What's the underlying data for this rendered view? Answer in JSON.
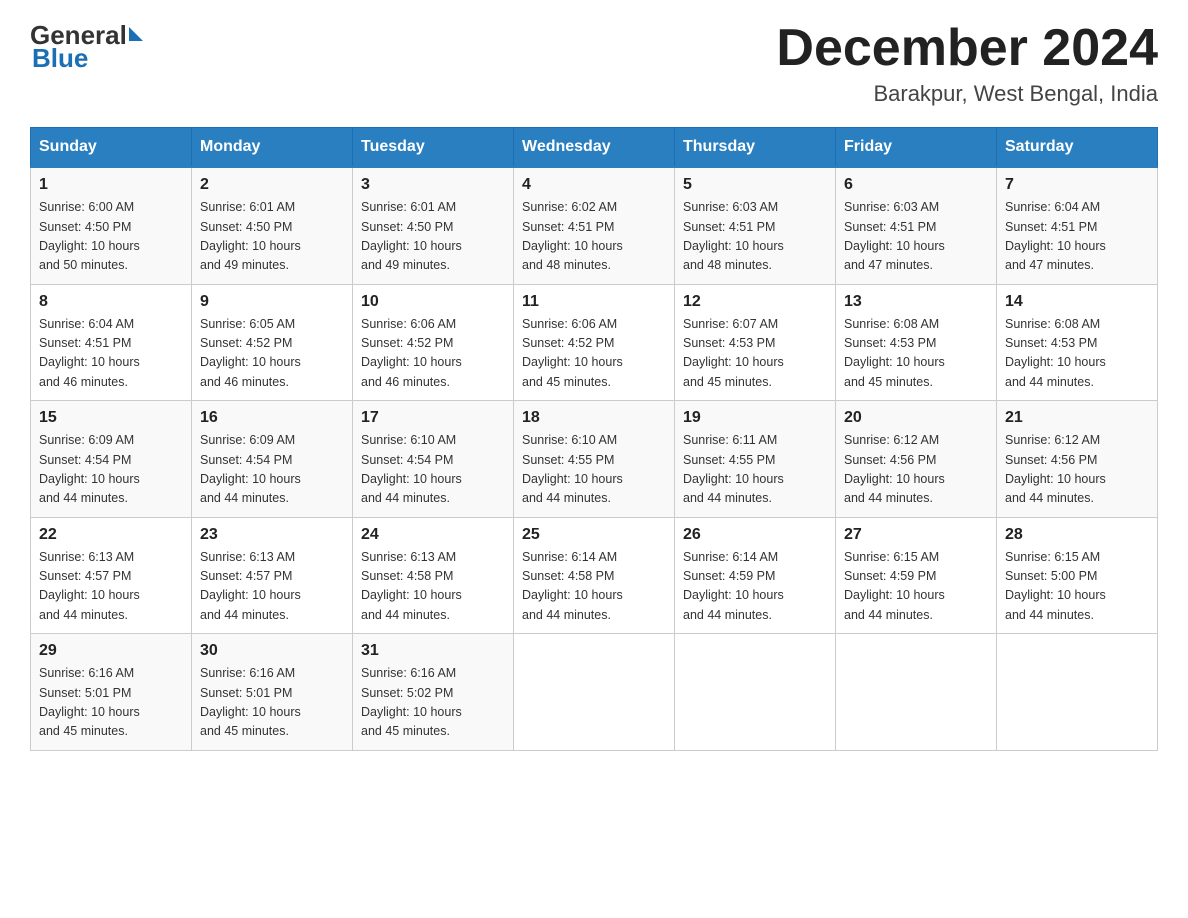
{
  "header": {
    "logo_general": "General",
    "logo_blue": "Blue",
    "month_title": "December 2024",
    "location": "Barakpur, West Bengal, India"
  },
  "days_of_week": [
    "Sunday",
    "Monday",
    "Tuesday",
    "Wednesday",
    "Thursday",
    "Friday",
    "Saturday"
  ],
  "weeks": [
    [
      {
        "day": "1",
        "sunrise": "6:00 AM",
        "sunset": "4:50 PM",
        "daylight": "10 hours and 50 minutes."
      },
      {
        "day": "2",
        "sunrise": "6:01 AM",
        "sunset": "4:50 PM",
        "daylight": "10 hours and 49 minutes."
      },
      {
        "day": "3",
        "sunrise": "6:01 AM",
        "sunset": "4:50 PM",
        "daylight": "10 hours and 49 minutes."
      },
      {
        "day": "4",
        "sunrise": "6:02 AM",
        "sunset": "4:51 PM",
        "daylight": "10 hours and 48 minutes."
      },
      {
        "day": "5",
        "sunrise": "6:03 AM",
        "sunset": "4:51 PM",
        "daylight": "10 hours and 48 minutes."
      },
      {
        "day": "6",
        "sunrise": "6:03 AM",
        "sunset": "4:51 PM",
        "daylight": "10 hours and 47 minutes."
      },
      {
        "day": "7",
        "sunrise": "6:04 AM",
        "sunset": "4:51 PM",
        "daylight": "10 hours and 47 minutes."
      }
    ],
    [
      {
        "day": "8",
        "sunrise": "6:04 AM",
        "sunset": "4:51 PM",
        "daylight": "10 hours and 46 minutes."
      },
      {
        "day": "9",
        "sunrise": "6:05 AM",
        "sunset": "4:52 PM",
        "daylight": "10 hours and 46 minutes."
      },
      {
        "day": "10",
        "sunrise": "6:06 AM",
        "sunset": "4:52 PM",
        "daylight": "10 hours and 46 minutes."
      },
      {
        "day": "11",
        "sunrise": "6:06 AM",
        "sunset": "4:52 PM",
        "daylight": "10 hours and 45 minutes."
      },
      {
        "day": "12",
        "sunrise": "6:07 AM",
        "sunset": "4:53 PM",
        "daylight": "10 hours and 45 minutes."
      },
      {
        "day": "13",
        "sunrise": "6:08 AM",
        "sunset": "4:53 PM",
        "daylight": "10 hours and 45 minutes."
      },
      {
        "day": "14",
        "sunrise": "6:08 AM",
        "sunset": "4:53 PM",
        "daylight": "10 hours and 44 minutes."
      }
    ],
    [
      {
        "day": "15",
        "sunrise": "6:09 AM",
        "sunset": "4:54 PM",
        "daylight": "10 hours and 44 minutes."
      },
      {
        "day": "16",
        "sunrise": "6:09 AM",
        "sunset": "4:54 PM",
        "daylight": "10 hours and 44 minutes."
      },
      {
        "day": "17",
        "sunrise": "6:10 AM",
        "sunset": "4:54 PM",
        "daylight": "10 hours and 44 minutes."
      },
      {
        "day": "18",
        "sunrise": "6:10 AM",
        "sunset": "4:55 PM",
        "daylight": "10 hours and 44 minutes."
      },
      {
        "day": "19",
        "sunrise": "6:11 AM",
        "sunset": "4:55 PM",
        "daylight": "10 hours and 44 minutes."
      },
      {
        "day": "20",
        "sunrise": "6:12 AM",
        "sunset": "4:56 PM",
        "daylight": "10 hours and 44 minutes."
      },
      {
        "day": "21",
        "sunrise": "6:12 AM",
        "sunset": "4:56 PM",
        "daylight": "10 hours and 44 minutes."
      }
    ],
    [
      {
        "day": "22",
        "sunrise": "6:13 AM",
        "sunset": "4:57 PM",
        "daylight": "10 hours and 44 minutes."
      },
      {
        "day": "23",
        "sunrise": "6:13 AM",
        "sunset": "4:57 PM",
        "daylight": "10 hours and 44 minutes."
      },
      {
        "day": "24",
        "sunrise": "6:13 AM",
        "sunset": "4:58 PM",
        "daylight": "10 hours and 44 minutes."
      },
      {
        "day": "25",
        "sunrise": "6:14 AM",
        "sunset": "4:58 PM",
        "daylight": "10 hours and 44 minutes."
      },
      {
        "day": "26",
        "sunrise": "6:14 AM",
        "sunset": "4:59 PM",
        "daylight": "10 hours and 44 minutes."
      },
      {
        "day": "27",
        "sunrise": "6:15 AM",
        "sunset": "4:59 PM",
        "daylight": "10 hours and 44 minutes."
      },
      {
        "day": "28",
        "sunrise": "6:15 AM",
        "sunset": "5:00 PM",
        "daylight": "10 hours and 44 minutes."
      }
    ],
    [
      {
        "day": "29",
        "sunrise": "6:16 AM",
        "sunset": "5:01 PM",
        "daylight": "10 hours and 45 minutes."
      },
      {
        "day": "30",
        "sunrise": "6:16 AM",
        "sunset": "5:01 PM",
        "daylight": "10 hours and 45 minutes."
      },
      {
        "day": "31",
        "sunrise": "6:16 AM",
        "sunset": "5:02 PM",
        "daylight": "10 hours and 45 minutes."
      },
      null,
      null,
      null,
      null
    ]
  ],
  "labels": {
    "sunrise": "Sunrise:",
    "sunset": "Sunset:",
    "daylight": "Daylight:"
  }
}
